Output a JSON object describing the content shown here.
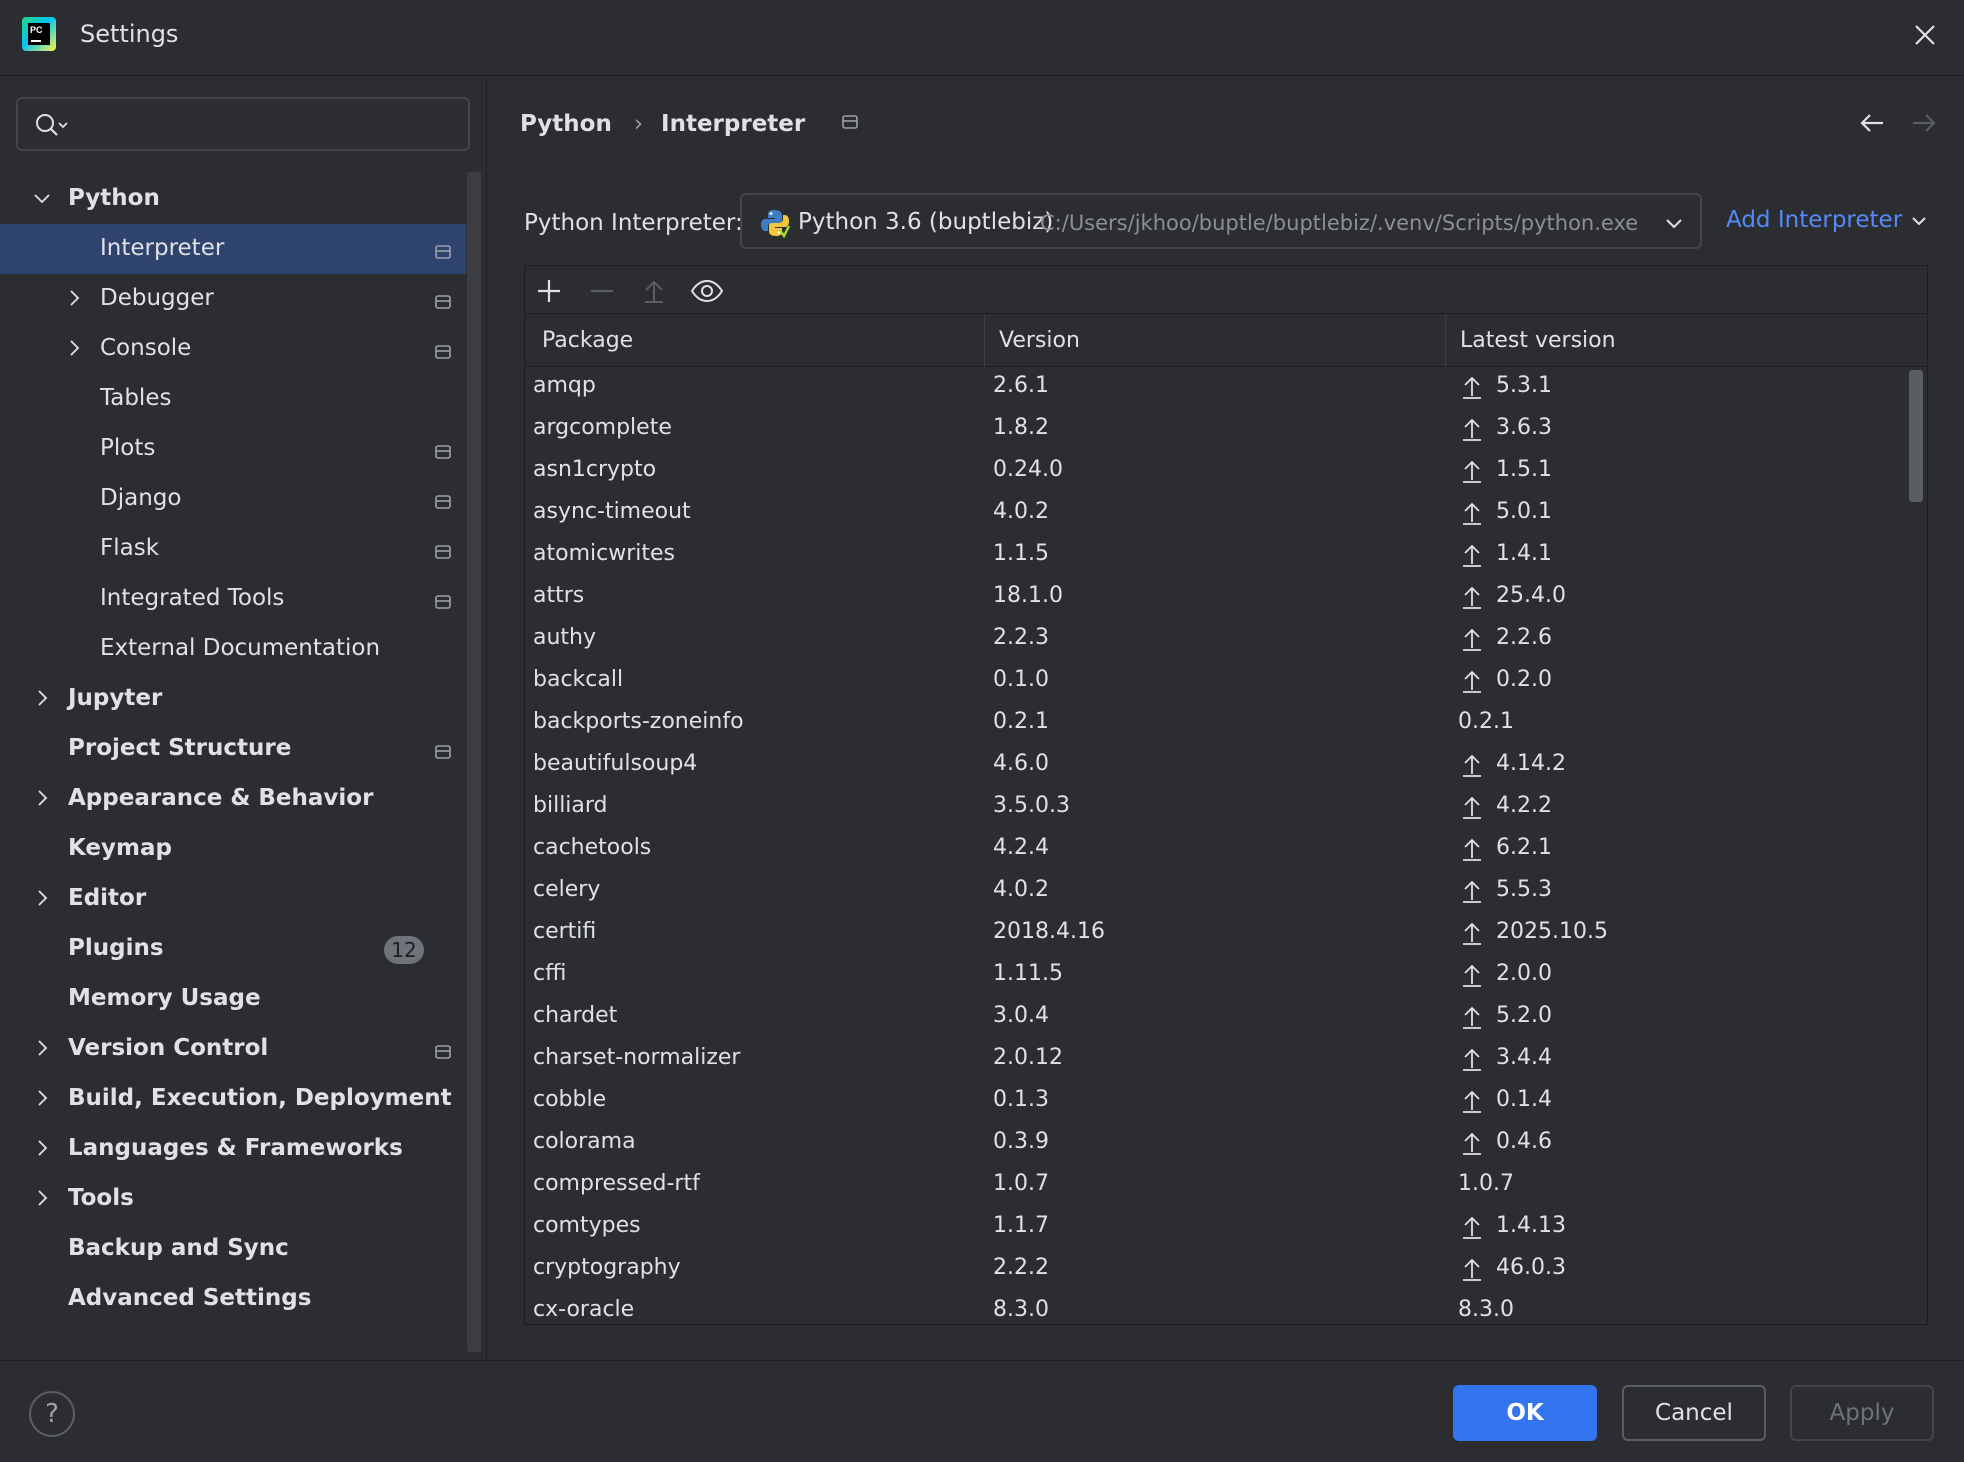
{
  "window": {
    "title": "Settings",
    "icons": {
      "app": "pycharm-logo",
      "close": "close-icon"
    }
  },
  "search": {
    "placeholder": "",
    "icon": "search-icon"
  },
  "tree": [
    {
      "label": "Python",
      "level": 0,
      "expandable": true,
      "expanded": true,
      "pin": false
    },
    {
      "label": "Interpreter",
      "level": 1,
      "selected": true,
      "pin": true
    },
    {
      "label": "Debugger",
      "level": 1,
      "expandable": true,
      "pin": true
    },
    {
      "label": "Console",
      "level": 1,
      "expandable": true,
      "pin": true
    },
    {
      "label": "Tables",
      "level": 1,
      "pin": false
    },
    {
      "label": "Plots",
      "level": 1,
      "pin": true
    },
    {
      "label": "Django",
      "level": 1,
      "pin": true
    },
    {
      "label": "Flask",
      "level": 1,
      "pin": true
    },
    {
      "label": "Integrated Tools",
      "level": 1,
      "pin": true
    },
    {
      "label": "External Documentation",
      "level": 1,
      "pin": false
    },
    {
      "label": "Jupyter",
      "level": 0,
      "expandable": true
    },
    {
      "label": "Project Structure",
      "level": 0,
      "pin": true
    },
    {
      "label": "Appearance & Behavior",
      "level": 0,
      "expandable": true
    },
    {
      "label": "Keymap",
      "level": 0
    },
    {
      "label": "Editor",
      "level": 0,
      "expandable": true
    },
    {
      "label": "Plugins",
      "level": 0,
      "badge": "12"
    },
    {
      "label": "Memory Usage",
      "level": 0
    },
    {
      "label": "Version Control",
      "level": 0,
      "expandable": true,
      "pin": true
    },
    {
      "label": "Build, Execution, Deployment",
      "level": 0,
      "expandable": true
    },
    {
      "label": "Languages & Frameworks",
      "level": 0,
      "expandable": true
    },
    {
      "label": "Tools",
      "level": 0,
      "expandable": true
    },
    {
      "label": "Backup and Sync",
      "level": 0
    },
    {
      "label": "Advanced Settings",
      "level": 0
    }
  ],
  "breadcrumb": {
    "parent": "Python",
    "current": "Interpreter",
    "separator": "›"
  },
  "interpreter": {
    "label": "Python Interpreter:",
    "name": "Python 3.6 (buptlebiz)",
    "path": "C:/Users/jkhoo/buptle/buptlebiz/.venv/Scripts/python.exe",
    "add_label": "Add Interpreter"
  },
  "table": {
    "columns": [
      "Package",
      "Version",
      "Latest version"
    ],
    "rows": [
      {
        "name": "amqp",
        "version": "2.6.1",
        "latest": "5.3.1",
        "upgrade": true
      },
      {
        "name": "argcomplete",
        "version": "1.8.2",
        "latest": "3.6.3",
        "upgrade": true
      },
      {
        "name": "asn1crypto",
        "version": "0.24.0",
        "latest": "1.5.1",
        "upgrade": true
      },
      {
        "name": "async-timeout",
        "version": "4.0.2",
        "latest": "5.0.1",
        "upgrade": true
      },
      {
        "name": "atomicwrites",
        "version": "1.1.5",
        "latest": "1.4.1",
        "upgrade": true
      },
      {
        "name": "attrs",
        "version": "18.1.0",
        "latest": "25.4.0",
        "upgrade": true
      },
      {
        "name": "authy",
        "version": "2.2.3",
        "latest": "2.2.6",
        "upgrade": true
      },
      {
        "name": "backcall",
        "version": "0.1.0",
        "latest": "0.2.0",
        "upgrade": true
      },
      {
        "name": "backports-zoneinfo",
        "version": "0.2.1",
        "latest": "0.2.1",
        "upgrade": false
      },
      {
        "name": "beautifulsoup4",
        "version": "4.6.0",
        "latest": "4.14.2",
        "upgrade": true
      },
      {
        "name": "billiard",
        "version": "3.5.0.3",
        "latest": "4.2.2",
        "upgrade": true
      },
      {
        "name": "cachetools",
        "version": "4.2.4",
        "latest": "6.2.1",
        "upgrade": true
      },
      {
        "name": "celery",
        "version": "4.0.2",
        "latest": "5.5.3",
        "upgrade": true
      },
      {
        "name": "certifi",
        "version": "2018.4.16",
        "latest": "2025.10.5",
        "upgrade": true
      },
      {
        "name": "cffi",
        "version": "1.11.5",
        "latest": "2.0.0",
        "upgrade": true
      },
      {
        "name": "chardet",
        "version": "3.0.4",
        "latest": "5.2.0",
        "upgrade": true
      },
      {
        "name": "charset-normalizer",
        "version": "2.0.12",
        "latest": "3.4.4",
        "upgrade": true
      },
      {
        "name": "cobble",
        "version": "0.1.3",
        "latest": "0.1.4",
        "upgrade": true
      },
      {
        "name": "colorama",
        "version": "0.3.9",
        "latest": "0.4.6",
        "upgrade": true
      },
      {
        "name": "compressed-rtf",
        "version": "1.0.7",
        "latest": "1.0.7",
        "upgrade": false
      },
      {
        "name": "comtypes",
        "version": "1.1.7",
        "latest": "1.4.13",
        "upgrade": true
      },
      {
        "name": "cryptography",
        "version": "2.2.2",
        "latest": "46.0.3",
        "upgrade": true
      },
      {
        "name": "cx-oracle",
        "version": "8.3.0",
        "latest": "8.3.0",
        "upgrade": false
      }
    ]
  },
  "footer": {
    "help": "?",
    "ok": "OK",
    "cancel": "Cancel",
    "apply": "Apply"
  },
  "colors": {
    "accent": "#3574f0",
    "selection": "#2e436e",
    "link": "#548af7",
    "background": "#2b2d30"
  }
}
